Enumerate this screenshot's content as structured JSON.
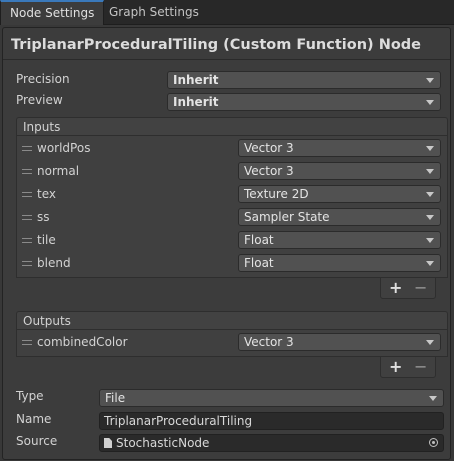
{
  "tabs": [
    "Node Settings",
    "Graph Settings"
  ],
  "title": "TriplanarProceduralTiling (Custom Function) Node",
  "precision": {
    "label": "Precision",
    "value": "Inherit"
  },
  "preview": {
    "label": "Preview",
    "value": "Inherit"
  },
  "inputs": {
    "header": "Inputs",
    "rows": [
      {
        "name": "worldPos",
        "type": "Vector 3"
      },
      {
        "name": "normal",
        "type": "Vector 3"
      },
      {
        "name": "tex",
        "type": "Texture 2D"
      },
      {
        "name": "ss",
        "type": "Sampler State"
      },
      {
        "name": "tile",
        "type": "Float"
      },
      {
        "name": "blend",
        "type": "Float"
      }
    ]
  },
  "outputs": {
    "header": "Outputs",
    "rows": [
      {
        "name": "combinedColor",
        "type": "Vector 3"
      }
    ]
  },
  "list_buttons": {
    "add": "+",
    "remove": "−"
  },
  "type": {
    "label": "Type",
    "value": "File"
  },
  "name": {
    "label": "Name",
    "value": "TriplanarProceduralTiling"
  },
  "source": {
    "label": "Source",
    "value": "StochasticNode"
  }
}
